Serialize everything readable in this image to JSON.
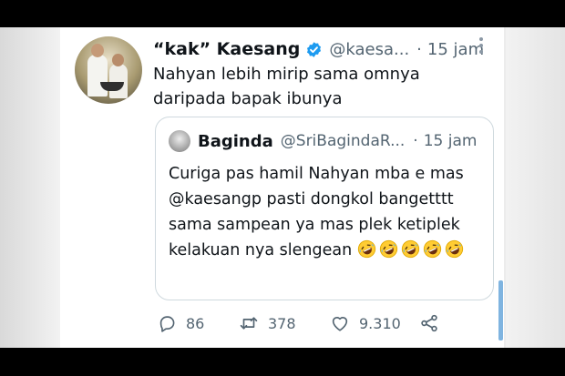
{
  "tweet": {
    "display_name": "“kak” Kaesang",
    "handle": "@kaesa...",
    "separator": "·",
    "time": "15 jam",
    "text": "Nahyan lebih mirip sama omnya daripada bapak ibunya",
    "verified": true,
    "avatar_icon": "profile-photo"
  },
  "quoted": {
    "display_name": "Baginda",
    "handle": "@SriBagindaR...",
    "separator": "·",
    "time": "15 jam",
    "text": "Curiga pas hamil Nahyan mba e mas @kaesangp pasti dongkol bangetttt sama sampean ya mas plek ketiplek kelakuan nya slengean",
    "emoji_icon": "rofl-emoji",
    "emoji_count": 5
  },
  "actions": {
    "reply_count": "86",
    "retweet_count": "378",
    "like_count": "9.310"
  },
  "icons": {
    "reply": "reply-icon",
    "retweet": "retweet-icon",
    "like": "heart-icon",
    "share": "share-icon",
    "more": "more-icon",
    "verified": "verified-badge-icon"
  },
  "colors": {
    "verified": "#1d9bf0",
    "secondary_text": "#536471",
    "primary_text": "#0f1419",
    "border": "#cfd9de"
  }
}
